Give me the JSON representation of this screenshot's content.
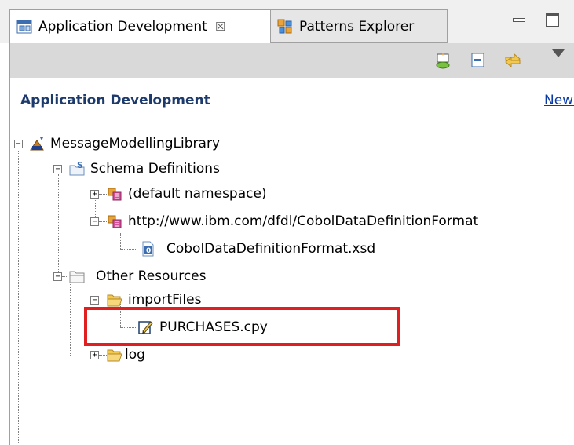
{
  "tabs": [
    {
      "label": "Application Development",
      "close": "☒",
      "active": true
    },
    {
      "label": "Patterns Explorer",
      "active": false
    }
  ],
  "header": {
    "title": "Application Development",
    "new_link": "New…"
  },
  "tree": {
    "root": "MessageModellingLibrary",
    "schema_definitions": "Schema Definitions",
    "default_namespace": "(default namespace)",
    "cobol_namespace": "http://www.ibm.com/dfdl/CobolDataDefinitionFormat",
    "cobol_xsd": "CobolDataDefinitionFormat.xsd",
    "other_resources": "Other Resources",
    "import_files": "importFiles",
    "purchases": "PURCHASES.cpy",
    "log": "log"
  },
  "colors": {
    "highlight": "#e02020",
    "header_title": "#1c3a6b",
    "link": "#0a3aa8"
  }
}
